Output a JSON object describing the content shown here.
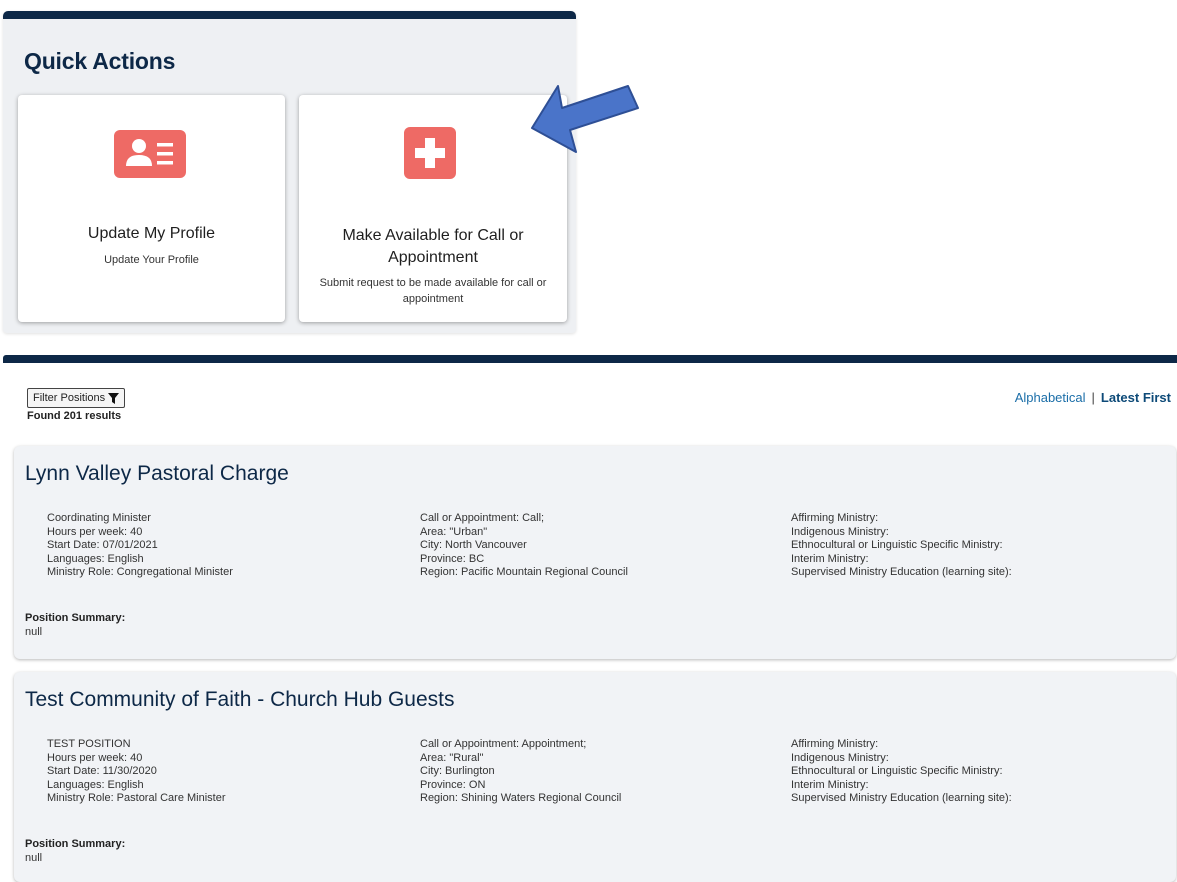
{
  "quick_actions": {
    "title": "Quick Actions",
    "cards": [
      {
        "title": "Update My Profile",
        "subtitle": "Update Your Profile",
        "icon": "profile-card-icon"
      },
      {
        "title": "Make Available for Call or Appointment",
        "subtitle": "Submit request to be made available for call or appointment",
        "icon": "plus-icon"
      }
    ]
  },
  "colors": {
    "accent": "#0d2847",
    "icon_bg": "#ee6a65",
    "arrow": "#4a74c9",
    "link": "#1b6ea8"
  },
  "results": {
    "filter_label": "Filter Positions",
    "found_text": "Found 201 results",
    "sort": {
      "alphabetical": "Alphabetical",
      "separator": "|",
      "latest": "Latest First"
    },
    "positions": [
      {
        "name": "Lynn Valley Pastoral Charge",
        "col1": [
          "Coordinating Minister",
          "Hours per week: 40",
          "Start Date: 07/01/2021",
          "Languages: English",
          "Ministry Role: Congregational Minister"
        ],
        "col2": [
          "Call or Appointment: Call;",
          "Area: \"Urban\"",
          "City: North Vancouver",
          "Province: BC",
          "Region: Pacific Mountain Regional Council"
        ],
        "col3": [
          "Affirming Ministry:",
          "Indigenous Ministry:",
          "Ethnocultural or Linguistic Specific Ministry:",
          "Interim Ministry:",
          "Supervised Ministry Education (learning site):"
        ],
        "summary_label": "Position Summary:",
        "summary": "null"
      },
      {
        "name": "Test Community of Faith - Church Hub Guests",
        "col1": [
          "TEST POSITION",
          "Hours per week: 40",
          "Start Date: 11/30/2020",
          "Languages: English",
          "Ministry Role: Pastoral Care Minister"
        ],
        "col2": [
          "Call or Appointment: Appointment;",
          "Area: \"Rural\"",
          "City: Burlington",
          "Province: ON",
          "Region: Shining Waters Regional Council"
        ],
        "col3": [
          "Affirming Ministry:",
          "Indigenous Ministry:",
          "Ethnocultural or Linguistic Specific Ministry:",
          "Interim Ministry:",
          "Supervised Ministry Education (learning site):"
        ],
        "summary_label": "Position Summary:",
        "summary": "null"
      }
    ]
  }
}
